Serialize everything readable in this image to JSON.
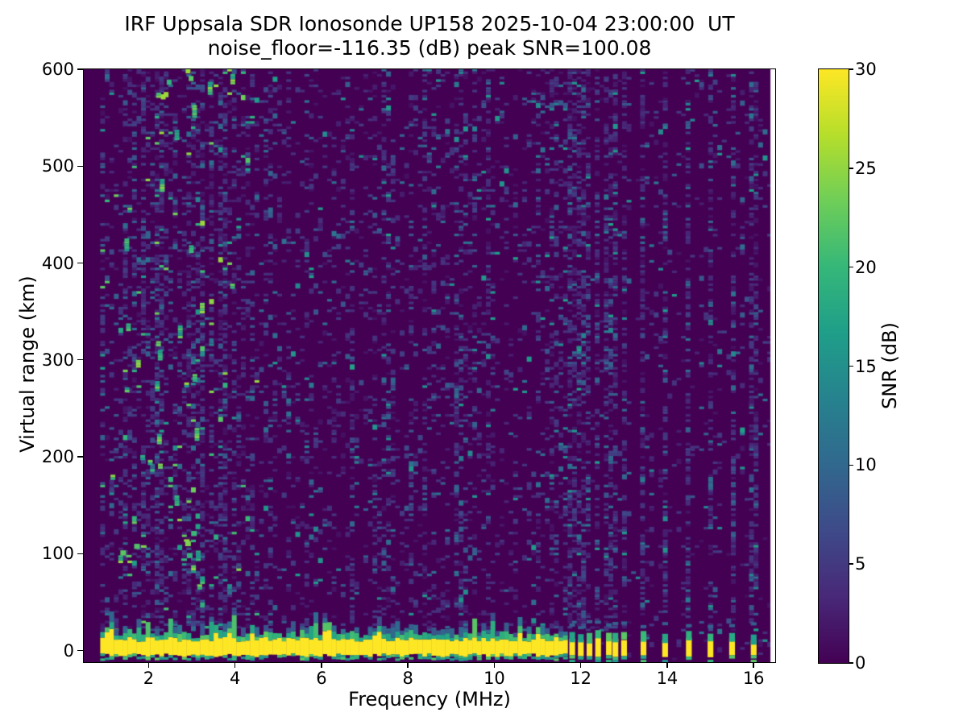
{
  "chart_data": {
    "type": "heatmap",
    "title": "IRF Uppsala SDR Ionosonde UP158 2025-10-04 23:00:00  UT",
    "subtitle": "noise_floor=-116.35 (dB) peak SNR=100.08",
    "station": "UP158",
    "timestamp_ut": "2025-10-04 23:00:00",
    "noise_floor_db": -116.35,
    "peak_snr_db": 100.08,
    "xlabel": "Frequency (MHz)",
    "ylabel": "Virtual range (km)",
    "xlim": [
      0.5,
      16.5
    ],
    "ylim": [
      -12,
      600
    ],
    "xticks": [
      2,
      4,
      6,
      8,
      10,
      12,
      14,
      16
    ],
    "yticks": [
      0,
      100,
      200,
      300,
      400,
      500,
      600
    ],
    "grid": false,
    "colorbar": {
      "label": "SNR (dB)",
      "vmin": 0,
      "vmax": 30,
      "ticks": [
        0,
        5,
        10,
        15,
        20,
        25,
        30
      ],
      "colormap": "viridis",
      "stops": [
        "#440154",
        "#482878",
        "#3e4a89",
        "#31688e",
        "#26828e",
        "#1f9e89",
        "#35b779",
        "#6ece58",
        "#b5de2b",
        "#fde725"
      ]
    },
    "features": {
      "data_freq_start_mhz": 0.88,
      "data_freq_end_mhz": 16.39,
      "sweep": {
        "freq_start_mhz": 0.88,
        "freq_end_mhz": 11.68,
        "ground_echo_center_km": 2,
        "ground_echo_top_km": 11,
        "ground_echo_bottom_km": -5,
        "peak_snr_db": 30
      },
      "discrete_frequencies_mhz": [
        11.8,
        12.0,
        12.2,
        12.4,
        12.65,
        12.8,
        13.0,
        13.45,
        13.95,
        14.5,
        15.0,
        15.5,
        16.0
      ],
      "noise_regions": {
        "dense_speckle_below_mhz": 4.2,
        "sparse_speckle_above_mhz": 11.7,
        "speckle_max_snr_db": 18
      }
    }
  }
}
